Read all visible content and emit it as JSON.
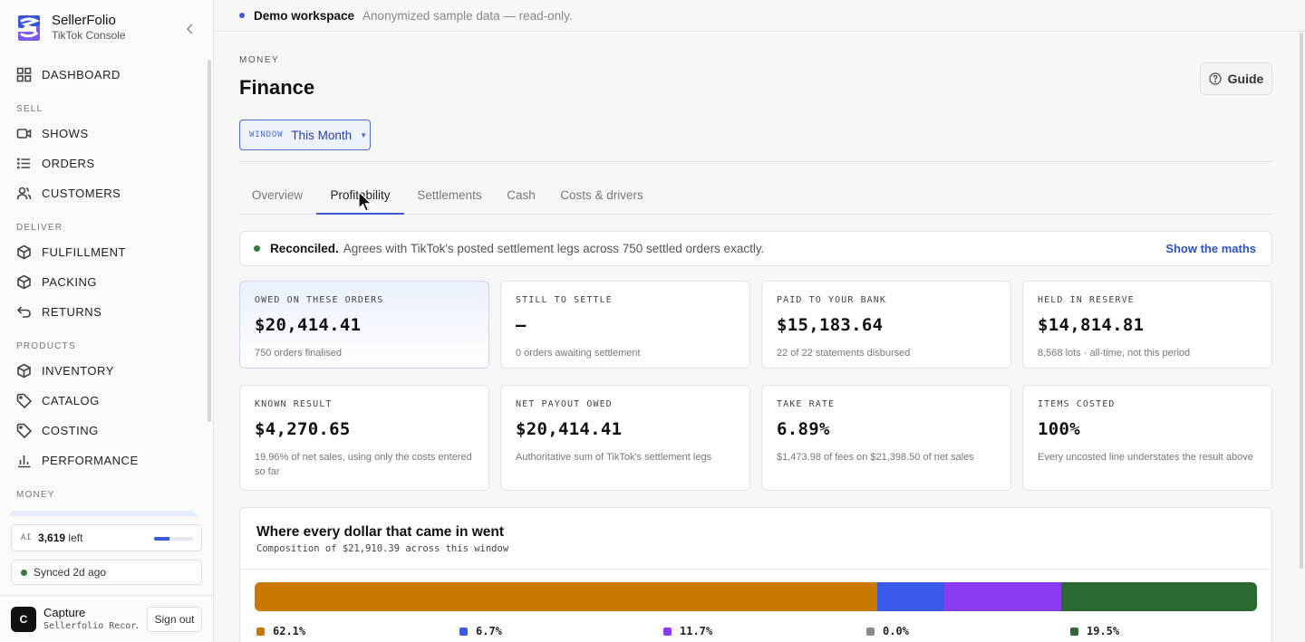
{
  "brand": {
    "name": "SellerFolio",
    "subtitle": "TikTok Console"
  },
  "sidebar": {
    "dashboard": "DASHBOARD",
    "sections": {
      "sell": "SELL",
      "deliver": "DELIVER",
      "products": "PRODUCTS",
      "money": "MONEY"
    },
    "items": {
      "shows": "SHOWS",
      "orders": "ORDERS",
      "customers": "CUSTOMERS",
      "fulfillment": "FULFILLMENT",
      "packing": "PACKING",
      "returns": "RETURNS",
      "inventory": "INVENTORY",
      "catalog": "CATALOG",
      "costing": "COSTING",
      "performance": "PERFORMANCE"
    },
    "ai": {
      "tag": "AI",
      "count": "3,619",
      "suffix": "left",
      "fill_fraction": 0.4
    },
    "sync": "Synced 2d ago",
    "user": {
      "initial": "C",
      "name": "Capture",
      "sub": "Sellerfolio Recor…",
      "sign_out": "Sign out"
    }
  },
  "topbar": {
    "workspace": "Demo workspace",
    "note": "Anonymized sample data — read-only."
  },
  "page": {
    "crumb": "MONEY",
    "title": "Finance",
    "guide": "Guide",
    "window": {
      "tag": "WINDOW",
      "value": "This Month"
    }
  },
  "tabs": {
    "overview": "Overview",
    "profitability": "Profitability",
    "settlements": "Settlements",
    "cash": "Cash",
    "costs": "Costs & drivers",
    "active": "Profitability"
  },
  "reconciled": {
    "title": "Reconciled.",
    "text": "Agrees with TikTok's posted settlement legs across 750 settled orders exactly.",
    "link": "Show the maths"
  },
  "cards": {
    "owed": {
      "label": "OWED ON THESE ORDERS",
      "value": "$20,414.41",
      "sub": "750 orders finalised"
    },
    "settle": {
      "label": "STILL TO SETTLE",
      "value": "—",
      "sub": "0 orders awaiting settlement"
    },
    "paid": {
      "label": "PAID TO YOUR BANK",
      "value": "$15,183.64",
      "sub": "22 of 22 statements disbursed"
    },
    "reserve": {
      "label": "HELD IN RESERVE",
      "value": "$14,814.81",
      "sub": "8,568 lots · all-time, not this period"
    },
    "known": {
      "label": "KNOWN RESULT",
      "value": "$4,270.65",
      "sub": "19.96% of net sales, using only the costs entered so far"
    },
    "net": {
      "label": "NET PAYOUT OWED",
      "value": "$20,414.41",
      "sub": "Authoritative sum of TikTok's settlement legs"
    },
    "take": {
      "label": "TAKE RATE",
      "value": "6.89%",
      "sub": "$1,473.98 of fees on $21,398.50 of net sales"
    },
    "items": {
      "label": "ITEMS COSTED",
      "value": "100%",
      "sub": "Every uncosted line understates the result above"
    }
  },
  "composition": {
    "title": "Where every dollar that came in went",
    "subtitle": "Composition of $21,910.39 across this window",
    "segments": [
      {
        "pct_label": "62.1%",
        "value": 62.1,
        "color": "#c97800"
      },
      {
        "pct_label": "6.7%",
        "value": 6.7,
        "color": "#3a5bea"
      },
      {
        "pct_label": "11.7%",
        "value": 11.7,
        "color": "#8a3cf0"
      },
      {
        "pct_label": "0.0%",
        "value": 0.0,
        "color": "#8a8a8a"
      },
      {
        "pct_label": "19.5%",
        "value": 19.5,
        "color": "#2a6a30"
      }
    ]
  },
  "colors": {
    "accent": "#3a5bd9",
    "success": "#2e7d32"
  }
}
